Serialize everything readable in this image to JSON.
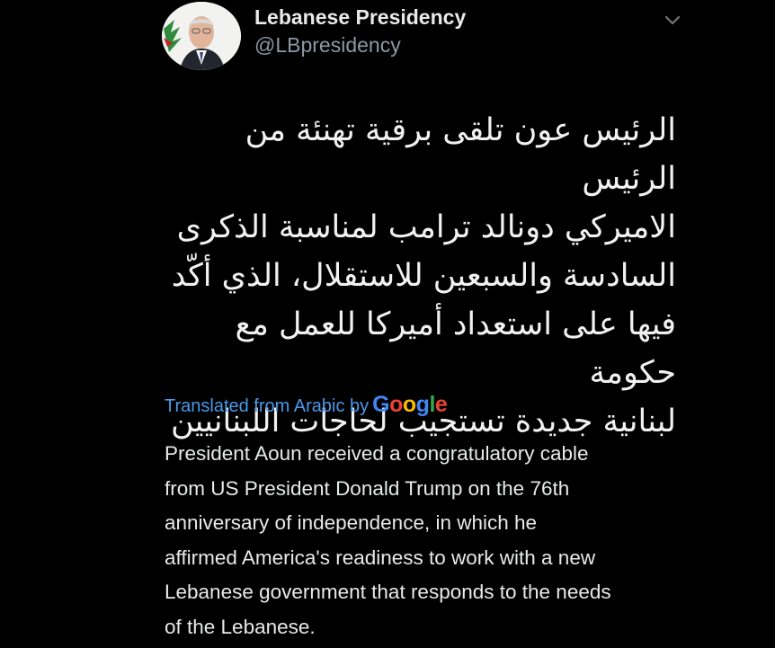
{
  "tweet": {
    "author": {
      "display_name": "Lebanese Presidency",
      "handle": "@LBpresidency",
      "avatar_icon": "avatar-portrait"
    },
    "menu_icon": "chevron-down-icon",
    "arabic_text": "الرئيس عون تلقى برقية تهنئة من الرئيس\nالاميركي دونالد ترامب لمناسبة الذكرى\nالسادسة والسبعين للاستقلال، الذي أكّد\nفيها على استعداد أميركا للعمل مع حكومة\nلبنانية جديدة تستجيب لحاجات اللبنانيين",
    "translation": {
      "label": "Translated from Arabic by",
      "provider_logo_text": {
        "g1": "G",
        "o1": "o",
        "o2": "o",
        "g2": "g",
        "l": "l",
        "e": "e"
      },
      "text": "President Aoun received a congratulatory cable\nfrom US President Donald Trump on the 76th\nanniversary of independence, in which he\naffirmed America's readiness to work with a new\nLebanese government that responds to the needs\nof the Lebanese."
    }
  },
  "colors": {
    "background": "#000000",
    "primary_text": "#e7e9ea",
    "secondary_text": "#8b98a5",
    "link_blue": "#4a99e9"
  }
}
